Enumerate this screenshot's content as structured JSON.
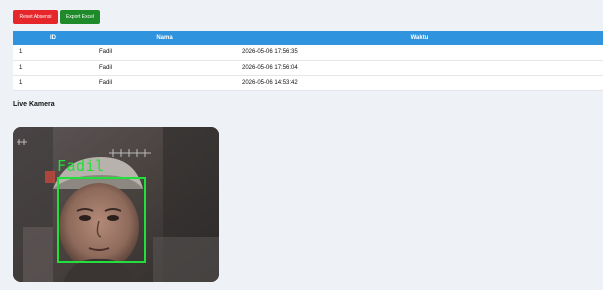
{
  "toolbar": {
    "reset_label": "Reset Absensi",
    "export_label": "Export Excel"
  },
  "table": {
    "columns": [
      "ID",
      "Nama",
      "Waktu"
    ],
    "rows": [
      {
        "id": "1",
        "nama": "Fadil",
        "waktu": "2026-05-06 17:56:35"
      },
      {
        "id": "1",
        "nama": "Fadil",
        "waktu": "2026-05-06 17:56:04"
      },
      {
        "id": "1",
        "nama": "Fadil",
        "waktu": "2026-05-06 14:53:42"
      }
    ]
  },
  "camera": {
    "title": "Live Kamera",
    "detected_name": "Fadil"
  },
  "colors": {
    "reset_button": "#e5262a",
    "export_button": "#1f8a2a",
    "table_header": "#2f93de",
    "detection_box": "#22e03a",
    "page_background": "#eef2f7"
  }
}
